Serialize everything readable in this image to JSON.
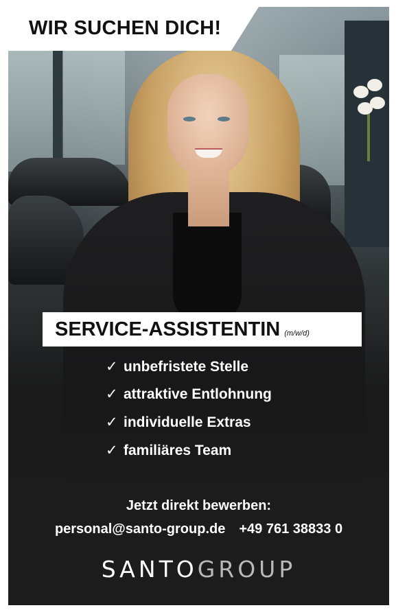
{
  "headline": "WIR SUCHEN DICH!",
  "role": {
    "title": "SERVICE-ASSISTENTIN",
    "suffix": "(m/w/d)"
  },
  "benefits": [
    {
      "check": "✓",
      "text": "unbefristete Stelle"
    },
    {
      "check": "✓",
      "text": "attraktive Entlohnung"
    },
    {
      "check": "✓",
      "text": "individuelle Extras"
    },
    {
      "check": "✓",
      "text": "familiäres Team"
    }
  ],
  "cta": "Jetzt direkt bewerben:",
  "contact": {
    "email": "personal@santo-group.de",
    "phone": "+49 761 38833 0"
  },
  "logo": {
    "part1": "SANTO",
    "part2": "GROUP"
  },
  "colors": {
    "background": "#1d1d1d",
    "text": "#ffffff",
    "box": "#ffffff"
  }
}
